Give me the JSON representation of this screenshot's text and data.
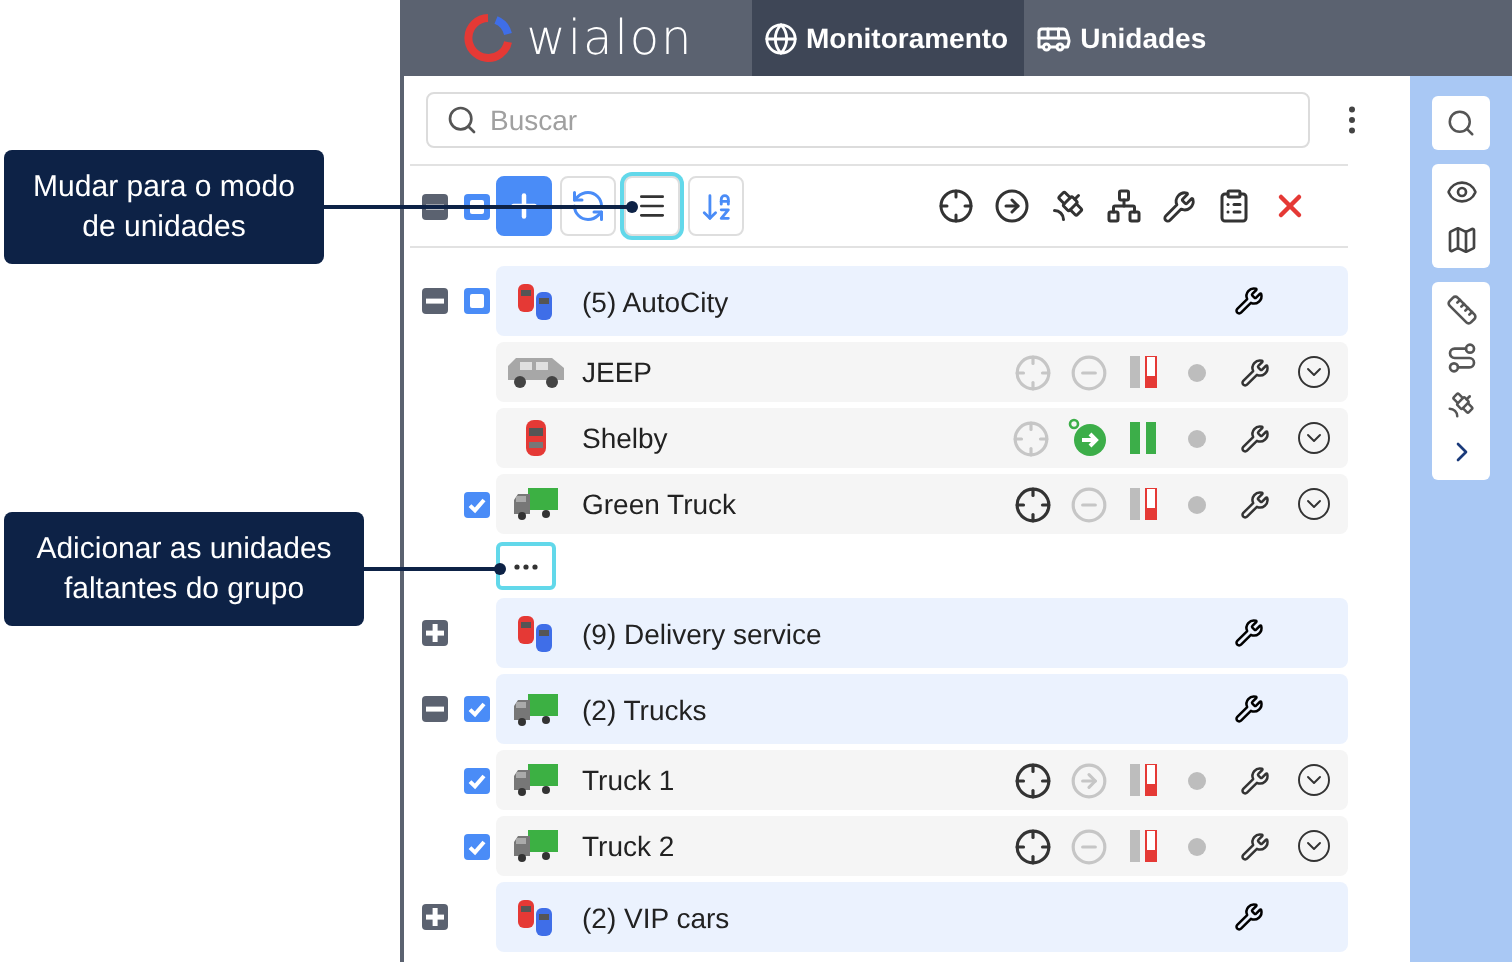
{
  "header": {
    "logo": "wialon",
    "tabs": [
      {
        "label": "Monitoramento",
        "kind": "globe",
        "selected": true
      },
      {
        "label": "Unidades",
        "kind": "bus",
        "selected": false
      }
    ]
  },
  "search": {
    "placeholder": "Buscar"
  },
  "toolbar": {
    "select_all_partial": true,
    "view_buttons": [
      {
        "kind": "add",
        "selected": true,
        "highlighted": false
      },
      {
        "kind": "refresh",
        "selected": false,
        "highlighted": false
      },
      {
        "kind": "list",
        "selected": false,
        "highlighted": true
      },
      {
        "kind": "sort",
        "selected": false,
        "highlighted": false
      }
    ]
  },
  "tree": [
    {
      "name": "(5) AutoCity",
      "kind": "cars",
      "expanded": true,
      "checked": false,
      "partial": true,
      "has_more": true,
      "children": [
        {
          "name": "JEEP",
          "kind": "jeep",
          "checked": false,
          "locator_active": false,
          "moving": false,
          "stopped": true,
          "signal_ok": false
        },
        {
          "name": "Shelby",
          "kind": "car",
          "checked": false,
          "locator_active": false,
          "moving": true,
          "signal_ok": true
        },
        {
          "name": "Green Truck",
          "kind": "truck",
          "checked": true,
          "locator_active": true,
          "moving": false,
          "stopped": true,
          "signal_ok": false
        }
      ]
    },
    {
      "name": "(9) Delivery service",
      "kind": "cars",
      "expanded": false,
      "checked": false,
      "partial": false,
      "has_more": false
    },
    {
      "name": "(2) Trucks",
      "kind": "truck",
      "expanded": true,
      "checked": true,
      "has_more": false,
      "children": [
        {
          "name": "Truck 1",
          "kind": "truck",
          "checked": true,
          "locator_active": true,
          "moving": false,
          "stopped": false,
          "signal_ok": false
        },
        {
          "name": "Truck 2",
          "kind": "truck",
          "checked": true,
          "locator_active": true,
          "moving": false,
          "stopped": true,
          "signal_ok": false
        }
      ]
    },
    {
      "name": "(2) VIP cars",
      "kind": "cars",
      "expanded": false,
      "checked": false,
      "partial": false,
      "has_more": false
    }
  ],
  "annotations": [
    {
      "text": "Mudar para o modo de unidades"
    },
    {
      "text": "Adicionar as unidades faltantes do grupo"
    }
  ]
}
